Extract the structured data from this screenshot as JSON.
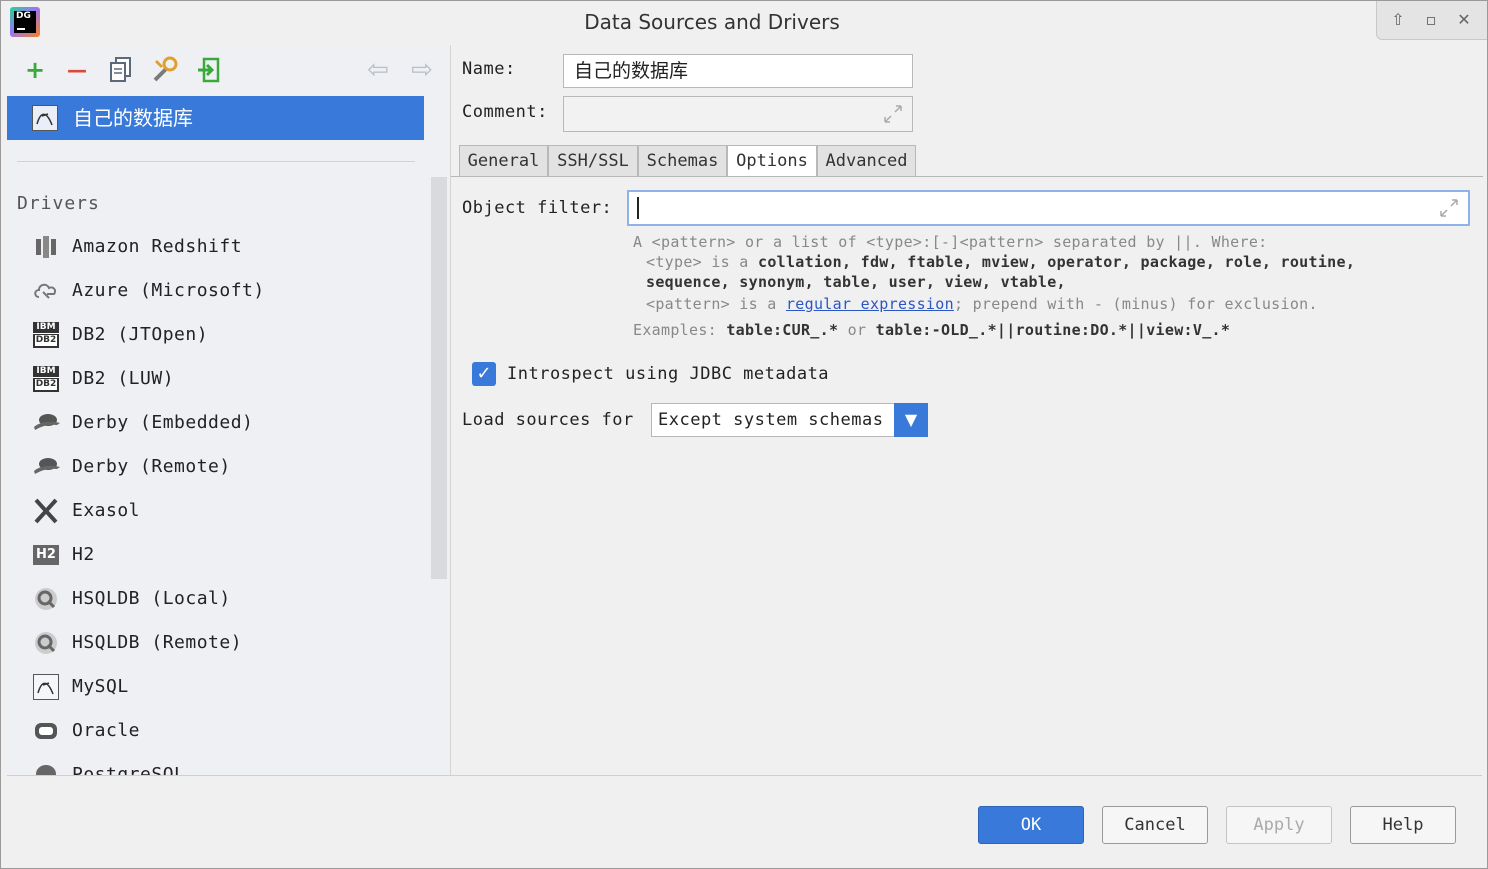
{
  "window": {
    "title": "Data Sources and Drivers"
  },
  "toolbar": {
    "add": "+",
    "remove": "—",
    "back": "⇦",
    "forward": "⇨"
  },
  "data_sources": [
    {
      "name": "自己的数据库",
      "icon": "mysql-icon"
    }
  ],
  "drivers": {
    "heading": "Drivers",
    "items": [
      {
        "name": "Amazon Redshift",
        "icon": "redshift-icon"
      },
      {
        "name": "Azure (Microsoft)",
        "icon": "azure-icon"
      },
      {
        "name": "DB2 (JTOpen)",
        "icon": "db2-icon",
        "badge_top": "IBM",
        "badge_bottom": "DB2"
      },
      {
        "name": "DB2 (LUW)",
        "icon": "db2-icon",
        "badge_top": "IBM",
        "badge_bottom": "DB2"
      },
      {
        "name": "Derby (Embedded)",
        "icon": "derby-icon"
      },
      {
        "name": "Derby (Remote)",
        "icon": "derby-icon"
      },
      {
        "name": "Exasol",
        "icon": "exasol-icon"
      },
      {
        "name": "H2",
        "icon": "h2-icon",
        "badge": "H2"
      },
      {
        "name": "HSQLDB (Local)",
        "icon": "hsqldb-icon"
      },
      {
        "name": "HSQLDB (Remote)",
        "icon": "hsqldb-icon"
      },
      {
        "name": "MySQL",
        "icon": "mysql-icon"
      },
      {
        "name": "Oracle",
        "icon": "oracle-icon"
      },
      {
        "name": "PostgreSQL",
        "icon": "postgresql-icon"
      }
    ]
  },
  "form": {
    "name_label": "Name:",
    "name_value": "自己的数据库",
    "comment_label": "Comment:",
    "comment_value": ""
  },
  "tabs": [
    "General",
    "SSH/SSL",
    "Schemas",
    "Options",
    "Advanced"
  ],
  "active_tab": "Options",
  "options": {
    "object_filter_label": "Object filter:",
    "object_filter_value": "",
    "help": {
      "l1": "A <pattern> or a list of <type>:[-]<pattern> separated by ||. Where:",
      "l2_prefix": "<type> is a ",
      "l2_types": "collation, fdw, ftable, mview, operator, package, role, routine,",
      "l3_types": "sequence, synonym, table, user, view, vtable,",
      "l4_prefix": "<pattern> is a ",
      "l4_link": "regular expression",
      "l4_suffix": "; prepend with - (minus) for exclusion.",
      "ex_prefix": "Examples: ",
      "ex_1": "table:CUR_.*",
      "ex_or": " or ",
      "ex_2": "table:-OLD_.*||routine:DO.*||view:V_.*"
    },
    "introspect_label": "Introspect using JDBC metadata",
    "introspect_checked": true,
    "load_sources_label": "Load sources for",
    "load_sources_value": "Except system schemas"
  },
  "buttons": {
    "ok": "OK",
    "cancel": "Cancel",
    "apply": "Apply",
    "help": "Help"
  },
  "colors": {
    "accent": "#3879d9",
    "link": "#2a56c6"
  }
}
